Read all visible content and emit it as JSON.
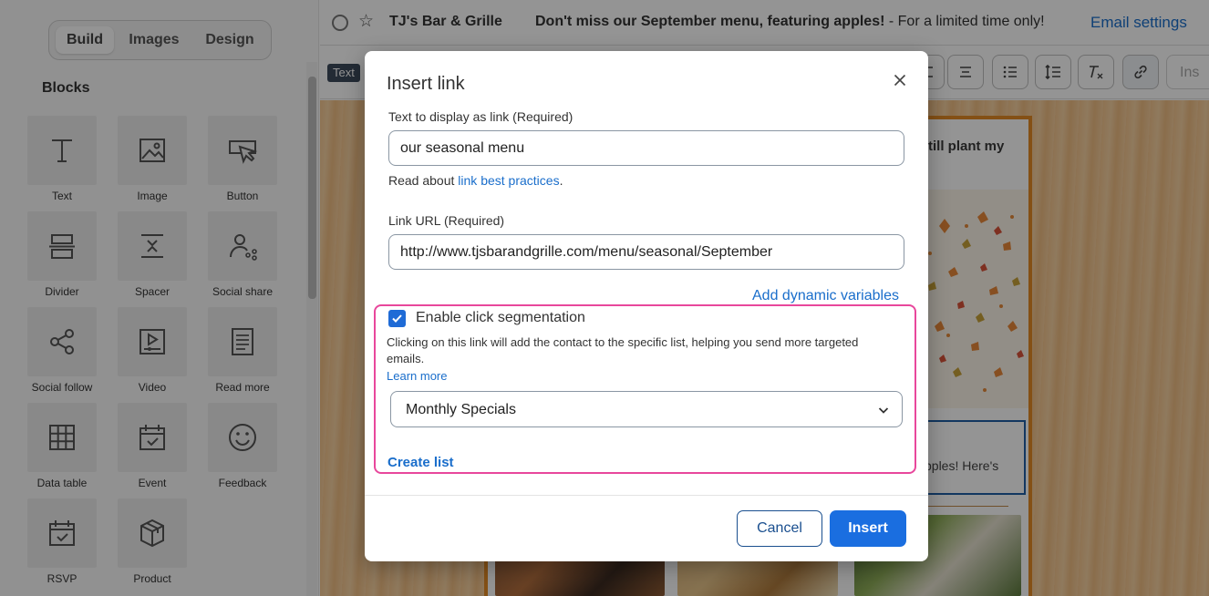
{
  "sidebar": {
    "tabs": [
      {
        "label": "Build",
        "active": true
      },
      {
        "label": "Images",
        "active": false
      },
      {
        "label": "Design",
        "active": false
      }
    ],
    "heading": "Blocks",
    "blocks": [
      {
        "label": "Text",
        "icon": "text-icon"
      },
      {
        "label": "Image",
        "icon": "image-icon"
      },
      {
        "label": "Button",
        "icon": "button-icon"
      },
      {
        "label": "Divider",
        "icon": "divider-icon"
      },
      {
        "label": "Spacer",
        "icon": "spacer-icon"
      },
      {
        "label": "Social share",
        "icon": "social-share-icon"
      },
      {
        "label": "Social follow",
        "icon": "social-follow-icon"
      },
      {
        "label": "Video",
        "icon": "video-icon"
      },
      {
        "label": "Read more",
        "icon": "read-more-icon"
      },
      {
        "label": "Data table",
        "icon": "data-table-icon"
      },
      {
        "label": "Event",
        "icon": "event-icon"
      },
      {
        "label": "Feedback",
        "icon": "feedback-icon"
      },
      {
        "label": "RSVP",
        "icon": "rsvp-icon"
      },
      {
        "label": "Product",
        "icon": "product-icon"
      }
    ]
  },
  "topbar": {
    "sender": "TJ's Bar & Grille",
    "subject_bold": "Don't miss our September menu, featuring apples!",
    "subject_rest": " - For a limited time only!",
    "settings_link": "Email settings"
  },
  "toolbar": {
    "block_type": "Text",
    "more_label": "Ins"
  },
  "email_preview": {
    "top_text": "till plant my",
    "mid_text": "pples! Here's"
  },
  "modal": {
    "title": "Insert link",
    "display_text_label": "Text to display as link  (Required)",
    "display_text_value": "our seasonal menu",
    "help_prefix": "Read about ",
    "help_link": "link best practices",
    "help_suffix": ".",
    "url_label": "Link URL  (Required)",
    "url_value": "http://www.tjsbarandgrille.com/menu/seasonal/September",
    "dynamic_link": "Add dynamic variables",
    "segmentation": {
      "checkbox_label": "Enable click segmentation",
      "checked": true,
      "description": "Clicking on this link will add the contact to the specific list, helping you send more targeted emails.",
      "learn_more": "Learn more",
      "selected_list": "Monthly Specials",
      "create_list": "Create list"
    },
    "cancel_label": "Cancel",
    "insert_label": "Insert"
  },
  "colors": {
    "accent": "#1a6ee0",
    "highlight": "#e8479c",
    "link": "#1a6ecb"
  }
}
